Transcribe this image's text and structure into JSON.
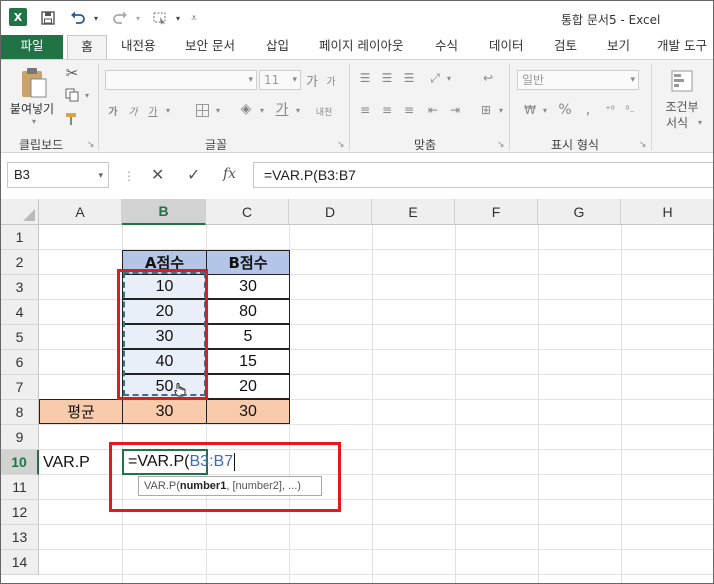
{
  "title_bar": {
    "window_title": "통합 문서5 - Excel",
    "app_icon": "excel-icon",
    "qat": [
      "save-icon",
      "undo-icon",
      "redo-icon",
      "select-objects-icon",
      "customize-qat-icon"
    ]
  },
  "tabs": [
    {
      "label": "파일"
    },
    {
      "label": "홈"
    },
    {
      "label": "내전용"
    },
    {
      "label": "보안 문서"
    },
    {
      "label": "삽입"
    },
    {
      "label": "페이지 레이아웃"
    },
    {
      "label": "수식"
    },
    {
      "label": "데이터"
    },
    {
      "label": "검토"
    },
    {
      "label": "보기"
    },
    {
      "label": "개발 도구"
    }
  ],
  "ribbon": {
    "clipboard": {
      "paste_label": "붙여넣기",
      "group_label": "클립보드"
    },
    "font": {
      "font_size": "11",
      "group_label": "글꼴",
      "bold": "가",
      "italic": "가",
      "underline": "가",
      "grow": "가",
      "shrink": "가",
      "phonetic": "내천"
    },
    "alignment": {
      "group_label": "맞춤"
    },
    "number": {
      "format": "일반",
      "percent": "%",
      "comma": ",",
      "group_label": "표시 형식"
    },
    "styles": {
      "conditional_label_1": "조건부",
      "conditional_label_2": "서식"
    }
  },
  "formula_bar": {
    "name_box": "B3",
    "cancel": "✕",
    "enter": "✓",
    "fx": "fx",
    "formula": "=VAR.P(B3:B7"
  },
  "columns": [
    "A",
    "B",
    "C",
    "D",
    "E",
    "F",
    "G",
    "H"
  ],
  "rows": [
    "1",
    "2",
    "3",
    "4",
    "5",
    "6",
    "7",
    "8",
    "9",
    "10",
    "11",
    "12",
    "13",
    "14"
  ],
  "table": {
    "header_a": "A점수",
    "header_b": "B점수",
    "a_values": [
      "10",
      "20",
      "30",
      "40",
      "50"
    ],
    "b_values": [
      "30",
      "80",
      "5",
      "15",
      "20"
    ],
    "avg_label": "평균",
    "avg_a": "30",
    "avg_b": "30"
  },
  "varp_label": "VAR.P",
  "edit_cell": {
    "prefix": "=VAR.P(",
    "ref": "B3:B7"
  },
  "tooltip": {
    "fn": "VAR.P(",
    "arg1": "number1",
    "rest": ", [number2], ...)"
  },
  "colors": {
    "excel_green": "#217346",
    "header_fill": "#b4c6e7",
    "avg_fill": "#f8cbad",
    "highlight_red": "#e21a1a"
  }
}
